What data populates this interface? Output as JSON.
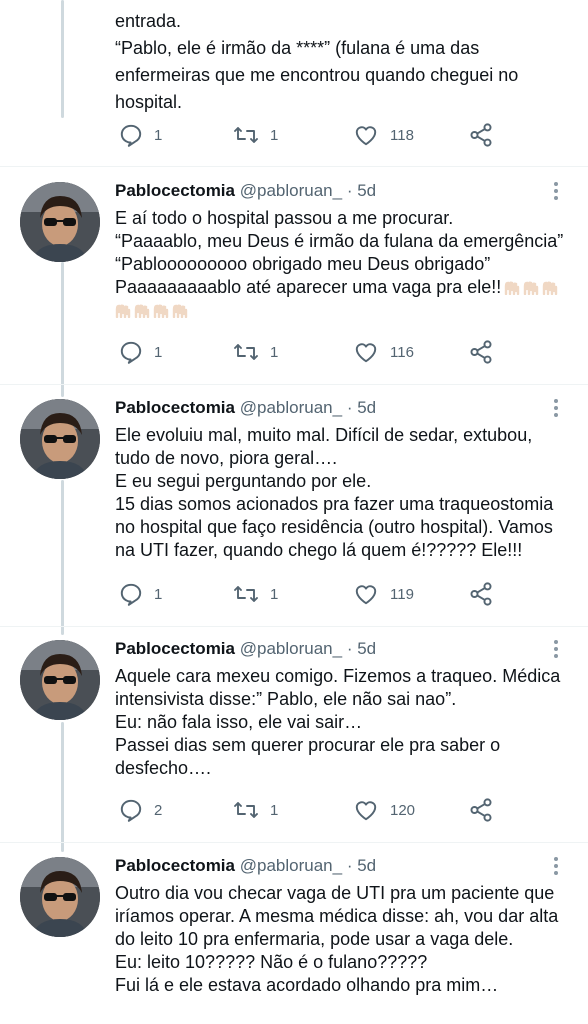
{
  "author": {
    "name": "Pablocectomia",
    "handle": "@pabloruan_",
    "separator": "·",
    "time": "5d"
  },
  "top_tweet": {
    "lines": [
      "entrada.",
      "“Pablo, ele é irmão da ****” (fulana é uma das",
      "enfermeiras que me encontrou quando cheguei no",
      "hospital."
    ],
    "replies": "1",
    "retweets": "1",
    "likes": "118"
  },
  "tweets": [
    {
      "lines": [
        "E aí todo o hospital passou a me procurar.",
        "“Paaaablo, meu Deus é irmão da fulana da emergência”",
        "“Pablooooooooo obrigado meu Deus obrigado”",
        "Paaaaaaaaablo até aparecer uma vaga pra ele!!"
      ],
      "emoji": "raised-hands-light-skin",
      "replies": "1",
      "retweets": "1",
      "likes": "116"
    },
    {
      "lines": [
        "Ele evoluiu mal, muito mal. Difícil de sedar, extubou,",
        "tudo de novo, piora geral….",
        "E eu segui perguntando por ele.",
        "15 dias somos acionados pra fazer uma traqueostomia",
        "no hospital que faço residência (outro hospital). Vamos",
        "na UTI fazer, quando chego lá quem é!????? Ele!!!"
      ],
      "replies": "1",
      "retweets": "1",
      "likes": "119"
    },
    {
      "lines": [
        "Aquele cara mexeu comigo. Fizemos a traqueo. Médica",
        "intensivista disse:” Pablo, ele não sai nao”.",
        "Eu: não fala isso, ele vai sair…",
        "Passei dias sem querer procurar ele pra saber o",
        "desfecho…."
      ],
      "replies": "2",
      "retweets": "1",
      "likes": "120"
    },
    {
      "lines": [
        "Outro dia vou checar vaga de UTI pra um paciente que",
        "iríamos operar. A mesma médica disse: ah, vou dar alta",
        "do leito 10 pra enfermaria, pode usar a vaga dele.",
        "Eu: leito 10????? Não é o fulano?????",
        "Fui lá e ele estava acordado olhando pra mim…"
      ]
    }
  ],
  "icons": {
    "reply": "reply-icon",
    "retweet": "retweet-icon",
    "like": "heart-icon",
    "share": "share-icon",
    "more": "more-vertical-icon"
  }
}
